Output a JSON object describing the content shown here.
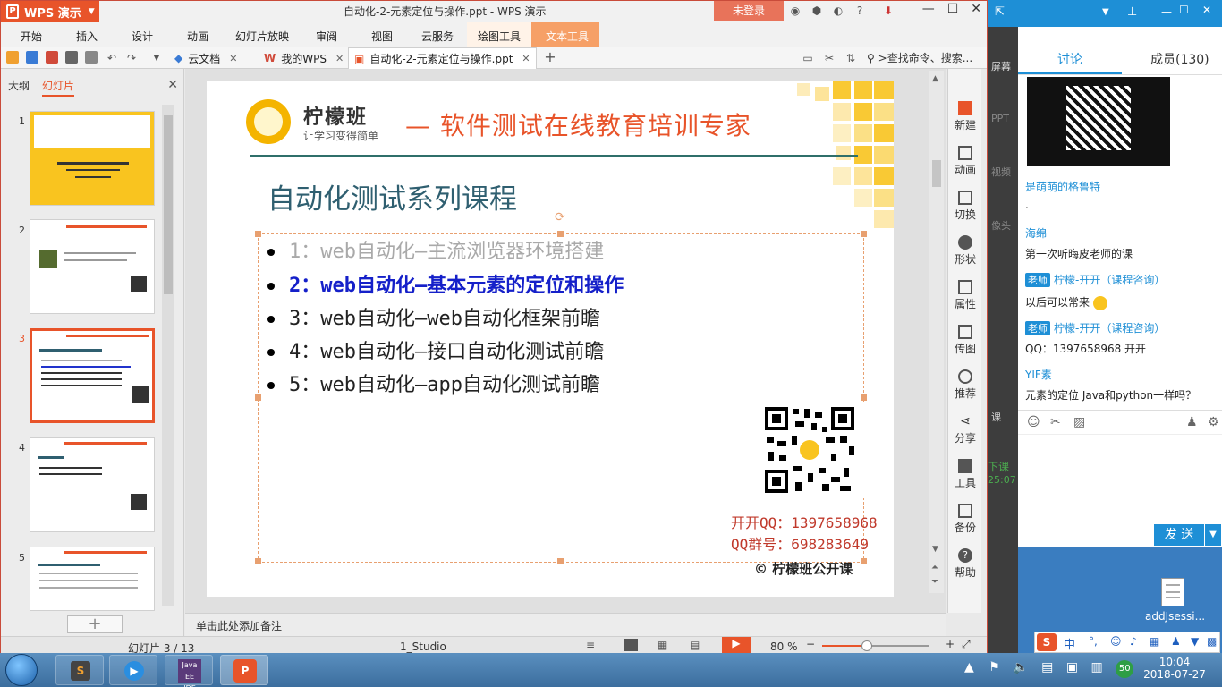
{
  "app": {
    "menu_label": "WPS 演示",
    "doc_title": "自动化-2-元素定位与操作.ppt - WPS 演示",
    "login": "未登录"
  },
  "menu": [
    "开始",
    "插入",
    "设计",
    "动画",
    "幻灯片放映",
    "审阅",
    "视图",
    "云服务",
    "绘图工具",
    "文本工具"
  ],
  "tabs": [
    {
      "label": "云文档"
    },
    {
      "label": "我的WPS"
    },
    {
      "label": "自动化-2-元素定位与操作.ppt"
    }
  ],
  "search_cmd": "查找命令、搜索...",
  "left_panel": {
    "tab_outline": "大纲",
    "tab_slides": "幻灯片",
    "thumb_numbers": [
      "1",
      "2",
      "3",
      "4",
      "5"
    ]
  },
  "slide": {
    "brand_name": "柠檬班",
    "brand_slogan": "让学习变得简单",
    "headline": "— 软件测试在线教育培训专家",
    "title": "自动化测试系列课程",
    "bullets": [
      "1：web自动化—主流浏览器环境搭建",
      "2：web自动化—基本元素的定位和操作",
      "3：web自动化—web自动化框架前瞻",
      "4：web自动化—接口自动化测试前瞻",
      "5：web自动化—app自动化测试前瞻"
    ],
    "qq_contact": "开开QQ：1397658968",
    "qq_group": "QQ群号：698283649",
    "copyright": "© 柠檬班公开课"
  },
  "notes_placeholder": "单击此处添加备注",
  "rtools": [
    "新建",
    "动画",
    "切换",
    "形状",
    "属性",
    "传图",
    "推荐",
    "分享",
    "工具",
    "备份",
    "帮助"
  ],
  "status": {
    "slide_index": "幻灯片 3 / 13",
    "theme": "1_Studio",
    "zoom": "80 %"
  },
  "chat": {
    "tab_discuss": "讨论",
    "tab_members": "成员(130)",
    "left_strip": [
      "屏幕",
      "PPT",
      "视频",
      "像头",
      "课"
    ],
    "messages": [
      {
        "name": "是萌萌的格鲁特",
        "text": "."
      },
      {
        "name": "海绵",
        "text": "第一次听晦皮老师的课"
      },
      {
        "name": "柠檬-开开（课程咨询）",
        "teacher_tag": "老师",
        "text": "以后可以常来"
      },
      {
        "name": "柠檬-开开（课程咨询）",
        "teacher_tag": "老师",
        "text": "QQ：1397658968 开开"
      },
      {
        "name": "YIF素",
        "text": "元素的定位 Java和python一样吗？"
      }
    ],
    "side_texts": [
      "下课",
      "25:07"
    ],
    "send": "发 送"
  },
  "desktop": {
    "file_label": "addJsessi..."
  },
  "taskbar": {
    "time": "10:04",
    "date": "2018-07-27",
    "badge": "50"
  }
}
